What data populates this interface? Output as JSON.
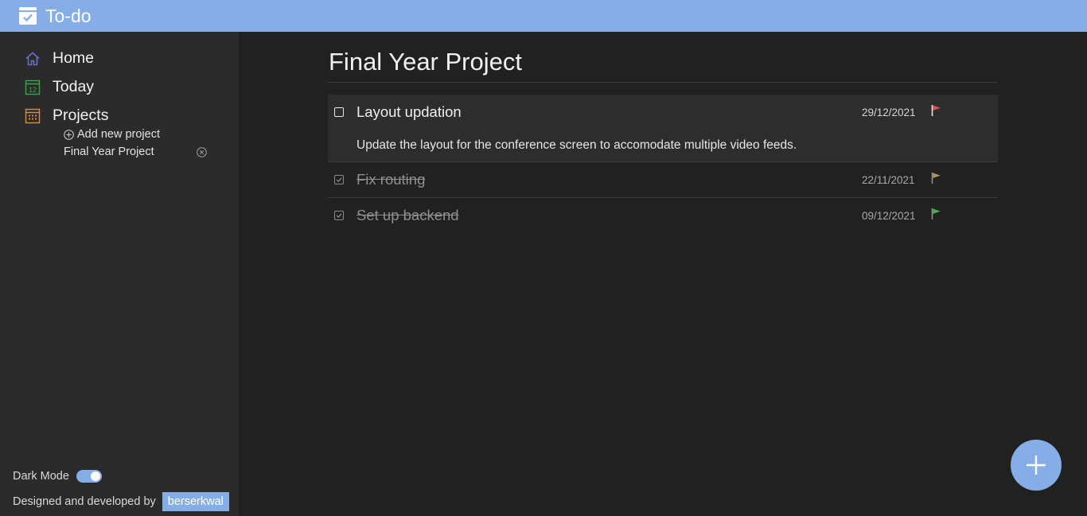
{
  "app": {
    "title": "To-do",
    "icon": "calendar-check-icon"
  },
  "sidebar": {
    "nav": [
      {
        "label": "Home",
        "icon": "home-icon",
        "color": "#6a6fc4"
      },
      {
        "label": "Today",
        "icon": "calendar-day-icon",
        "day": "12",
        "color": "#3fa34d"
      },
      {
        "label": "Projects",
        "icon": "calendar-grid-icon",
        "color": "#e08a3c"
      }
    ],
    "add_project_label": "Add new project",
    "projects": [
      {
        "label": "Final Year Project"
      }
    ],
    "dark_mode": {
      "label": "Dark Mode",
      "enabled": true
    },
    "credits": {
      "text": "Designed and developed by",
      "author": "berserkwal"
    }
  },
  "main": {
    "title": "Final Year Project",
    "tasks": [
      {
        "title": "Layout updation",
        "date": "29/12/2021",
        "done": false,
        "expanded": true,
        "priority_color": "#e05252",
        "description": "Update the layout for the conference screen to accomodate multiple video feeds."
      },
      {
        "title": "Fix routing",
        "date": "22/11/2021",
        "done": true,
        "priority_color": "#a89a5a"
      },
      {
        "title": "Set up backend",
        "date": "09/12/2021",
        "done": true,
        "priority_color": "#4caf50"
      }
    ]
  },
  "colors": {
    "accent": "#86aee6",
    "sidebar_bg": "#2b2b2b",
    "main_bg": "#212121"
  }
}
